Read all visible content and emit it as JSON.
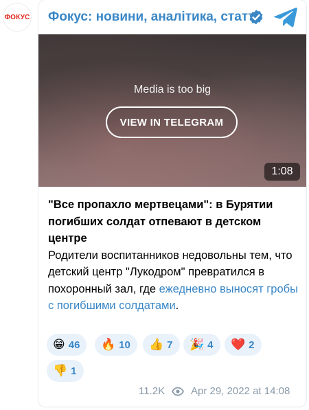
{
  "avatar": {
    "text": "ФОКУС",
    "color": "#e1251b"
  },
  "channel": {
    "name": "Фокус: новини, аналітика, статті",
    "name_color": "#3a87c6",
    "verified_icon": "verified-badge-icon",
    "share_icon": "telegram-plane-icon"
  },
  "media": {
    "notice": "Media is too big",
    "button_label": "VIEW IN TELEGRAM",
    "duration": "1:08"
  },
  "post": {
    "title": "\"Все пропахло мертвецами\": в Бурятии погибших солдат отпевают в детском центре",
    "body": "Родители воспитанников недовольны тем, что детский центр \"Лукодром\" превратился в похоронный зал, где ",
    "link_text": "ежедневно выносят гробы с погибшими солдатами",
    "end": "."
  },
  "reactions": [
    {
      "emoji": "😁",
      "count": "46",
      "icon": "grinning-face-icon"
    },
    {
      "emoji": "🔥",
      "count": "10",
      "icon": "fire-icon"
    },
    {
      "emoji": "👍",
      "count": "7",
      "icon": "thumbs-up-icon"
    },
    {
      "emoji": "🎉",
      "count": "4",
      "icon": "party-popper-icon"
    },
    {
      "emoji": "❤️",
      "count": "2",
      "icon": "heart-icon"
    },
    {
      "emoji": "👎",
      "count": "1",
      "icon": "thumbs-down-icon"
    }
  ],
  "footer": {
    "views": "11.2K",
    "date": "Apr 29, 2022 at 14:08"
  },
  "colors": {
    "accent": "#3a87c6",
    "reaction_bg": "#e9f2fb",
    "meta_text": "#8a9aa9"
  }
}
